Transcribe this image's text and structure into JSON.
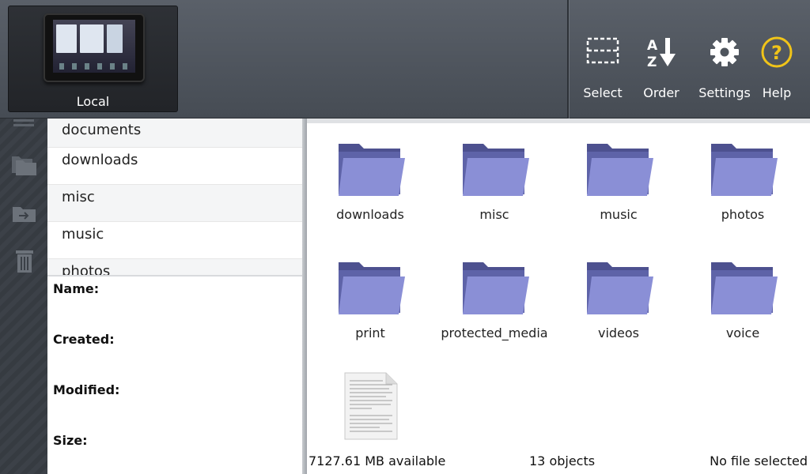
{
  "device": {
    "label": "Local"
  },
  "toolbar": {
    "select": {
      "label": "Select",
      "icon": "select-icon"
    },
    "order": {
      "label": "Order",
      "icon": "sort-az-icon"
    },
    "settings": {
      "label": "Settings",
      "icon": "gear-icon"
    },
    "help": {
      "label": "Help",
      "icon": "help-icon"
    }
  },
  "rail": [
    "list-view-icon",
    "copy-folder-icon",
    "move-folder-icon",
    "trash-icon"
  ],
  "folder_list": [
    "documents",
    "downloads",
    "misc",
    "music",
    "photos"
  ],
  "details": {
    "name_label": "Name:",
    "created_label": "Created:",
    "modified_label": "Modified:",
    "size_label": "Size:"
  },
  "grid": [
    {
      "label": "downloads",
      "type": "folder"
    },
    {
      "label": "misc",
      "type": "folder"
    },
    {
      "label": "music",
      "type": "folder"
    },
    {
      "label": "photos",
      "type": "folder"
    },
    {
      "label": "print",
      "type": "folder"
    },
    {
      "label": "protected_media",
      "type": "folder"
    },
    {
      "label": "videos",
      "type": "folder"
    },
    {
      "label": "voice",
      "type": "folder"
    },
    {
      "label": "",
      "type": "file"
    }
  ],
  "status": {
    "available": "7127.61 MB available",
    "objects": "13 objects",
    "selection": "No file selected"
  },
  "colors": {
    "folder": "#7f84c8",
    "accent_help": "#f0c419"
  }
}
